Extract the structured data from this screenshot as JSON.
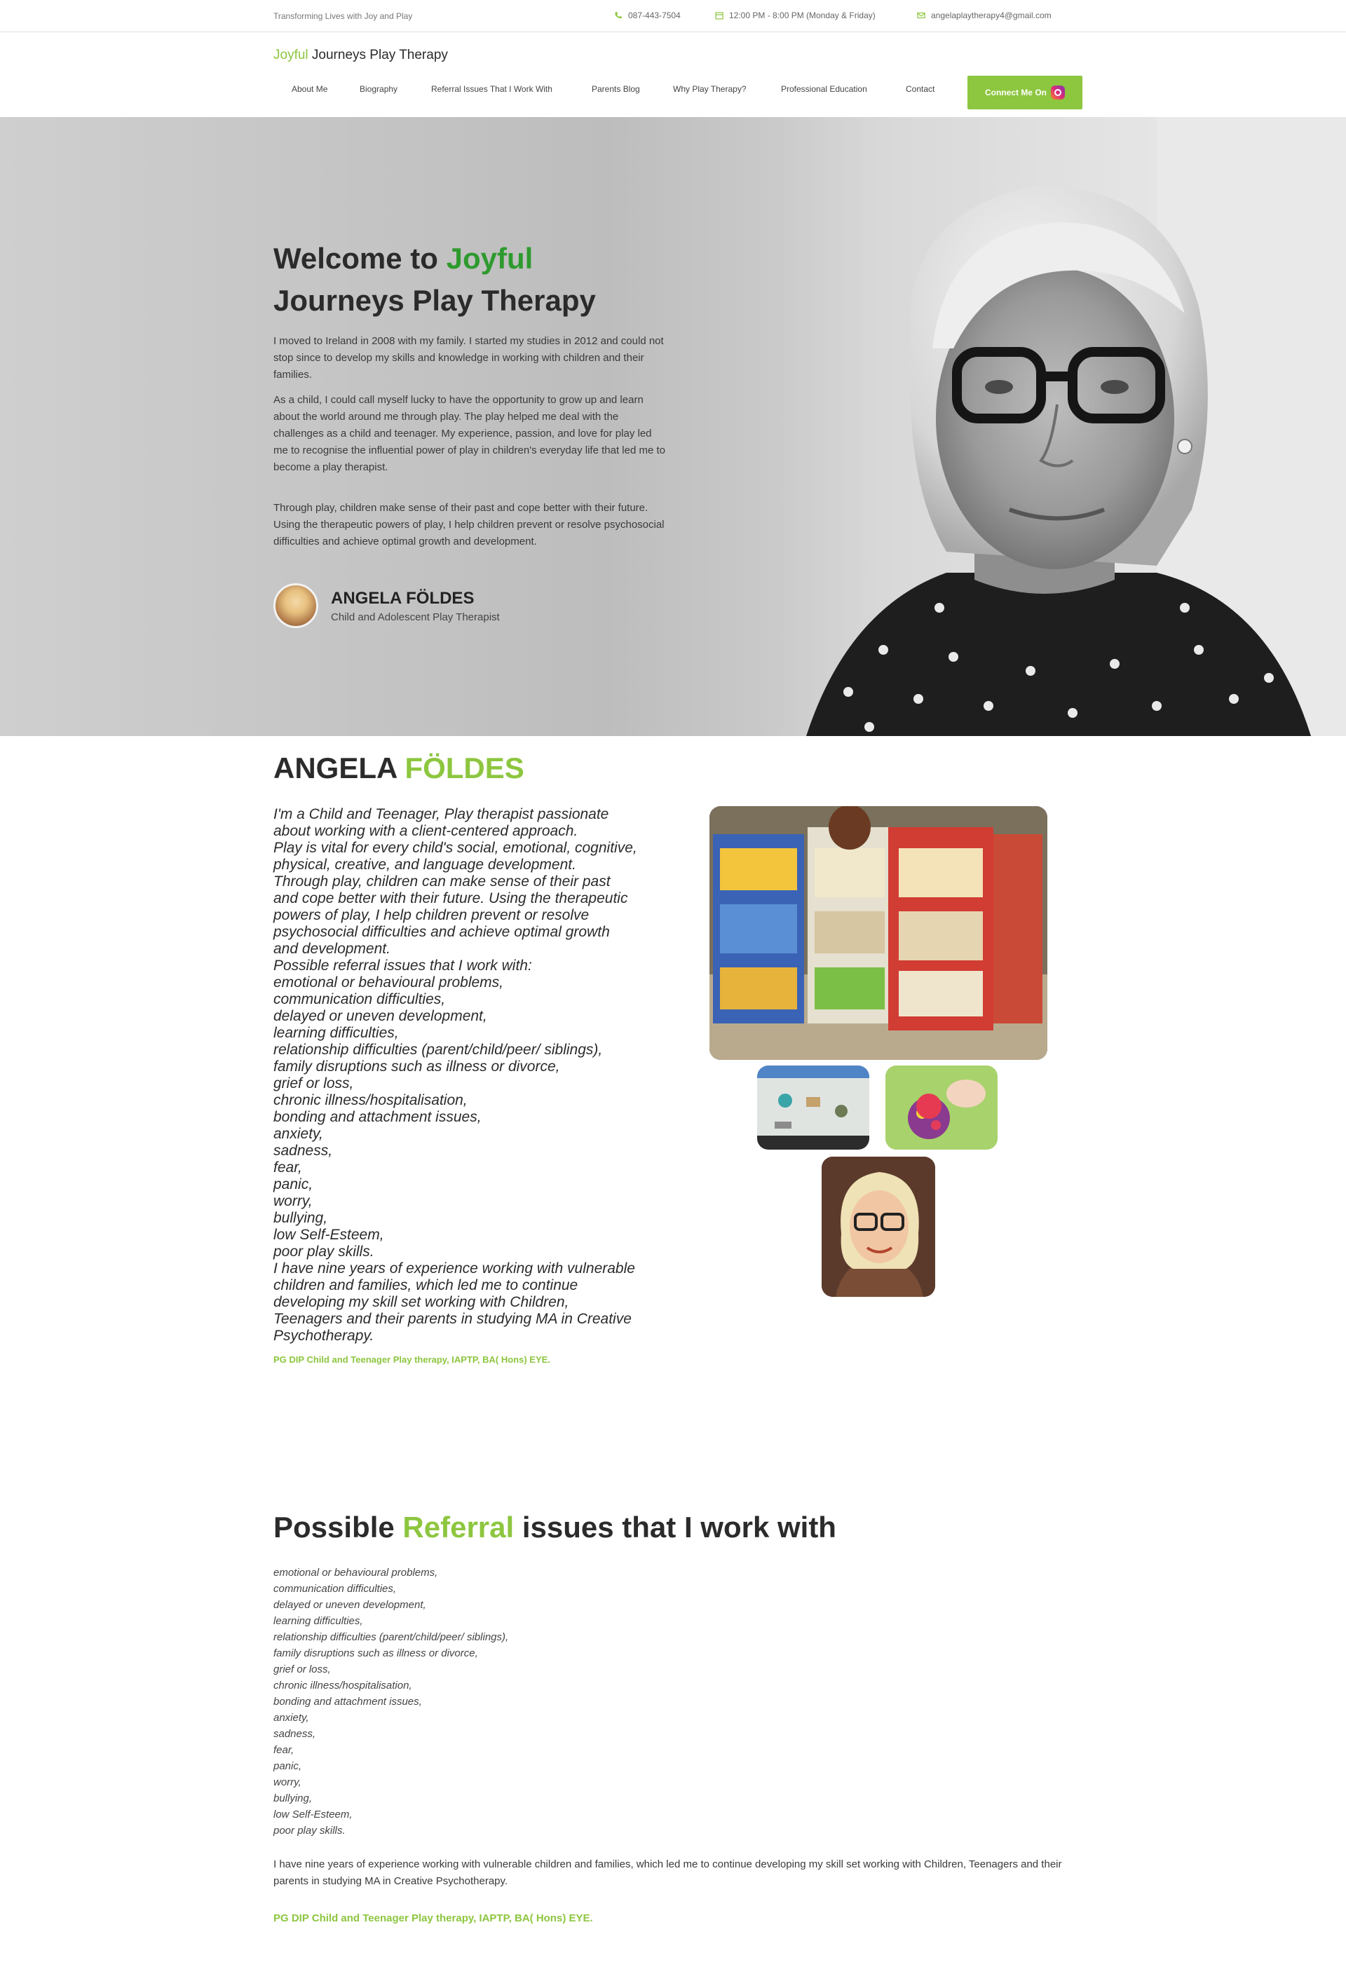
{
  "topbar": {
    "tagline": "Transforming Lives with Joy and Play",
    "phone": "087-443-7504",
    "hours": "12:00 PM - 8:00 PM (Monday & Friday)",
    "email": "angelaplaytherapy4@gmail.com"
  },
  "header": {
    "logo_accent": "Joyful",
    "logo_rest": "Journeys Play Therapy",
    "nav": [
      "About Me",
      "Biography",
      "Referral Issues That I Work With",
      "Parents Blog",
      "Why Play Therapy?",
      "Professional Education",
      "Contact"
    ],
    "cta_label": "Connect Me On",
    "cta_icon": "instagram-icon"
  },
  "hero": {
    "title_pre": "Welcome to",
    "title_accent": "Joyful",
    "title_post": "Journeys Play Therapy",
    "p1": "I moved to Ireland in 2008 with my family. I started my studies in 2012 and could not stop since to develop my skills and knowledge in working with children and their families.",
    "p2": "As a child, I could call myself lucky to have the opportunity to grow up and learn about the world around me through play. The play helped me deal with the challenges as a child and teenager. My experience, passion, and love for play led me to recognise the influential power of play in children's everyday life that led me to become a play therapist.",
    "p3": "Through play, children make sense of their past and cope better with their future. Using the therapeutic powers of play, I help children prevent or resolve psychosocial difficulties and achieve optimal growth and development.",
    "author_name": "ANGELA FÖLDES",
    "author_role": "Child and Adolescent Play Therapist"
  },
  "about": {
    "title_pre": "ANGELA",
    "title_accent": "FÖLDES",
    "lines": [
      "I'm a Child and Teenager, Play therapist passionate",
      "about working with a client-centered approach.",
      "Play is vital for every child's social, emotional, cognitive,",
      "physical, creative, and language development.",
      "Through play, children can make sense of their past",
      "and cope better with their future. Using the therapeutic",
      "powers of play, I help children prevent or resolve",
      "psychosocial difficulties and achieve optimal growth",
      "and development.",
      "Possible referral issues that I work with:",
      "emotional or behavioural problems,",
      "communication difficulties,",
      "delayed or uneven development,",
      "learning difficulties,",
      "relationship difficulties (parent/child/peer/ siblings),",
      "family disruptions such as illness or divorce,",
      "grief or loss,",
      "chronic illness/hospitalisation,",
      "bonding and attachment issues,",
      "anxiety,",
      "sadness,",
      "fear,",
      "panic,",
      "worry,",
      "bullying,",
      "low Self-Esteem,",
      "poor play skills.",
      "I have nine years of experience working with vulnerable",
      "children and families, which led me to continue",
      "developing my skill set working with Children,",
      "Teenagers and their parents in studying MA in Creative",
      "Psychotherapy."
    ],
    "qualification": "PG DIP Child and Teenager Play therapy, IAPTP, BA( Hons) EYE."
  },
  "referral": {
    "title_pre": "Possible",
    "title_accent": "Referral",
    "title_post": "issues that I work with",
    "items": [
      "emotional or behavioural problems,",
      "communication difficulties,",
      "delayed or uneven development,",
      "learning difficulties,",
      "relationship difficulties (parent/child/peer/ siblings),",
      "family disruptions such as illness or divorce,",
      "grief or loss,",
      "chronic illness/hospitalisation,",
      "bonding and attachment issues,",
      "anxiety,",
      "sadness,",
      "fear,",
      "panic,",
      "worry,",
      "bullying,",
      "low Self-Esteem,",
      "poor play skills."
    ],
    "experience": "I have nine years of experience working with vulnerable children and families, which led me to continue developing my skill set working with Children, Teenagers and their parents in studying MA in Creative Psychotherapy.",
    "qualification": "PG DIP Child and Teenager Play therapy, IAPTP, BA( Hons) EYE."
  },
  "colors": {
    "accent_green": "#8dc63f",
    "hero_green": "#2e9a2e"
  }
}
